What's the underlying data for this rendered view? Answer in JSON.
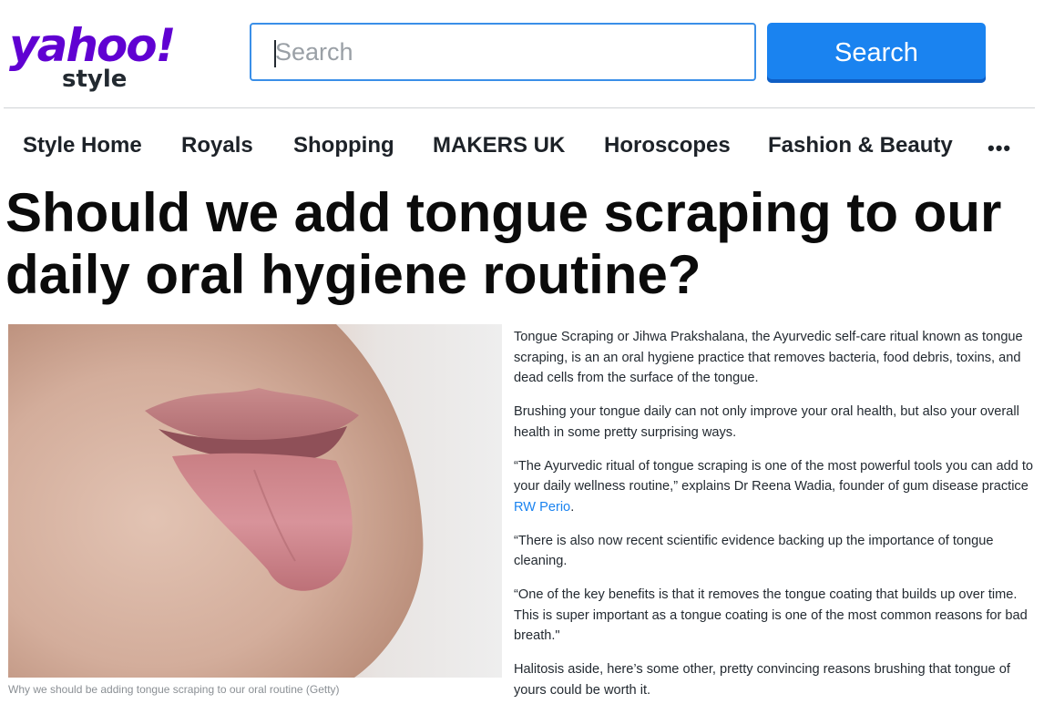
{
  "header": {
    "logo_brand": "yahoo!",
    "logo_sub": "style",
    "search_placeholder": "Search",
    "search_button_label": "Search"
  },
  "nav": {
    "items": [
      {
        "label": "Style Home"
      },
      {
        "label": "Royals"
      },
      {
        "label": "Shopping"
      },
      {
        "label": "MAKERS UK"
      },
      {
        "label": "Horoscopes"
      },
      {
        "label": "Fashion & Beauty"
      }
    ],
    "more_label": "•••"
  },
  "article": {
    "headline": "Should we add tongue scraping to our daily oral hygiene routine?",
    "image_caption": "Why we should be adding tongue scraping to our oral routine (Getty)",
    "paragraphs": [
      "Tongue Scraping or Jihwa Prakshalana, the Ayurvedic self-care ritual known as tongue scraping, is an an oral hygiene practice that removes bacteria, food debris, toxins, and dead cells from the surface of the tongue.",
      "Brushing your tongue daily can not only improve your oral health, but also your overall health in some pretty surprising ways.",
      "“There is also now recent scientific evidence backing up the importance of tongue cleaning.",
      "“One of the key benefits is that it removes the tongue coating that builds up over time. This is super important as a tongue coating is one of the most common reasons for bad breath.\"",
      "Halitosis aside, here’s some other, pretty convincing reasons brushing that tongue of yours could be worth it."
    ],
    "quote_paragraph": {
      "before_link": "“The Ayurvedic ritual of tongue scraping is one of the most powerful tools you can add to your daily wellness routine,” explains Dr Reena Wadia, founder of gum disease practice ",
      "link_text": "RW Perio",
      "after_link": "."
    }
  },
  "colors": {
    "brand_purple": "#6001d2",
    "search_blue": "#1a83f0",
    "link_blue": "#1a83f0"
  }
}
